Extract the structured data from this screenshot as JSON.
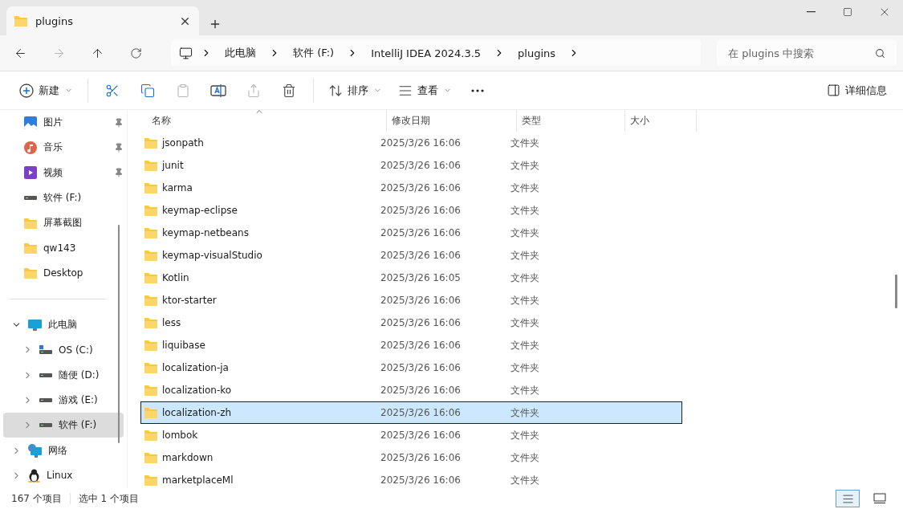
{
  "tab": {
    "title": "plugins",
    "selected": true
  },
  "nav": {
    "back_disabled": false,
    "forward_disabled": true
  },
  "breadcrumb": [
    "此电脑",
    "软件 (F:)",
    "IntelliJ IDEA 2024.3.5",
    "plugins"
  ],
  "search": {
    "placeholder": "在 plugins 中搜索"
  },
  "toolbar": [
    {
      "kind": "new",
      "label": "新建",
      "disabled": false
    },
    {
      "kind": "cut",
      "disabled": false
    },
    {
      "kind": "copy",
      "disabled": false
    },
    {
      "kind": "paste",
      "disabled": true
    },
    {
      "kind": "rename",
      "disabled": false
    },
    {
      "kind": "share",
      "disabled": true
    },
    {
      "kind": "delete",
      "disabled": false
    },
    {
      "kind": "sort",
      "label": "排序",
      "disabled": false
    },
    {
      "kind": "view",
      "label": "查看",
      "disabled": false
    },
    {
      "kind": "more",
      "disabled": false
    }
  ],
  "details_button": "详细信息",
  "quick_access": [
    {
      "kind": "pictures",
      "label": "图片",
      "pinned": true
    },
    {
      "kind": "music",
      "label": "音乐",
      "pinned": true
    },
    {
      "kind": "videos",
      "label": "视频",
      "pinned": true
    },
    {
      "kind": "drive",
      "label": "软件 (F:)",
      "pinned": false
    },
    {
      "kind": "folder",
      "label": "屏幕截图",
      "pinned": false
    },
    {
      "kind": "folder",
      "label": "qw143",
      "pinned": false
    },
    {
      "kind": "folder",
      "label": "Desktop",
      "pinned": false
    }
  ],
  "tree": [
    {
      "kind": "pc",
      "label": "此电脑",
      "expanded": true,
      "selected": false,
      "children": [
        {
          "kind": "system-drive",
          "label": "OS (C:)",
          "expanded": false,
          "selected": false
        },
        {
          "kind": "drive",
          "label": "随便 (D:)",
          "expanded": false,
          "selected": false
        },
        {
          "kind": "drive",
          "label": "游戏 (E:)",
          "expanded": false,
          "selected": false
        },
        {
          "kind": "drive",
          "label": "软件 (F:)",
          "expanded": false,
          "selected": true
        }
      ]
    },
    {
      "kind": "network",
      "label": "网络",
      "expanded": false,
      "selected": false
    },
    {
      "kind": "linux",
      "label": "Linux",
      "expanded": false,
      "selected": false
    }
  ],
  "table": {
    "columns": [
      "名称",
      "修改日期",
      "类型",
      "大小"
    ],
    "rows": [
      {
        "name": "jsonpath",
        "modified": "2025/3/26 16:06",
        "type": "文件夹",
        "selected": false
      },
      {
        "name": "junit",
        "modified": "2025/3/26 16:06",
        "type": "文件夹",
        "selected": false
      },
      {
        "name": "karma",
        "modified": "2025/3/26 16:06",
        "type": "文件夹",
        "selected": false
      },
      {
        "name": "keymap-eclipse",
        "modified": "2025/3/26 16:06",
        "type": "文件夹",
        "selected": false
      },
      {
        "name": "keymap-netbeans",
        "modified": "2025/3/26 16:06",
        "type": "文件夹",
        "selected": false
      },
      {
        "name": "keymap-visualStudio",
        "modified": "2025/3/26 16:06",
        "type": "文件夹",
        "selected": false
      },
      {
        "name": "Kotlin",
        "modified": "2025/3/26 16:05",
        "type": "文件夹",
        "selected": false
      },
      {
        "name": "ktor-starter",
        "modified": "2025/3/26 16:06",
        "type": "文件夹",
        "selected": false
      },
      {
        "name": "less",
        "modified": "2025/3/26 16:06",
        "type": "文件夹",
        "selected": false
      },
      {
        "name": "liquibase",
        "modified": "2025/3/26 16:06",
        "type": "文件夹",
        "selected": false
      },
      {
        "name": "localization-ja",
        "modified": "2025/3/26 16:06",
        "type": "文件夹",
        "selected": false
      },
      {
        "name": "localization-ko",
        "modified": "2025/3/26 16:06",
        "type": "文件夹",
        "selected": false
      },
      {
        "name": "localization-zh",
        "modified": "2025/3/26 16:06",
        "type": "文件夹",
        "selected": true
      },
      {
        "name": "lombok",
        "modified": "2025/3/26 16:06",
        "type": "文件夹",
        "selected": false
      },
      {
        "name": "markdown",
        "modified": "2025/3/26 16:06",
        "type": "文件夹",
        "selected": false
      },
      {
        "name": "marketplaceMl",
        "modified": "2025/3/26 16:06",
        "type": "文件夹",
        "selected": false
      }
    ]
  },
  "status_bar": {
    "item_count": "167 个项目",
    "selection": "选中 1 个项目"
  },
  "view_modes": [
    {
      "kind": "details",
      "selected": true
    },
    {
      "kind": "tiles",
      "selected": false
    }
  ]
}
